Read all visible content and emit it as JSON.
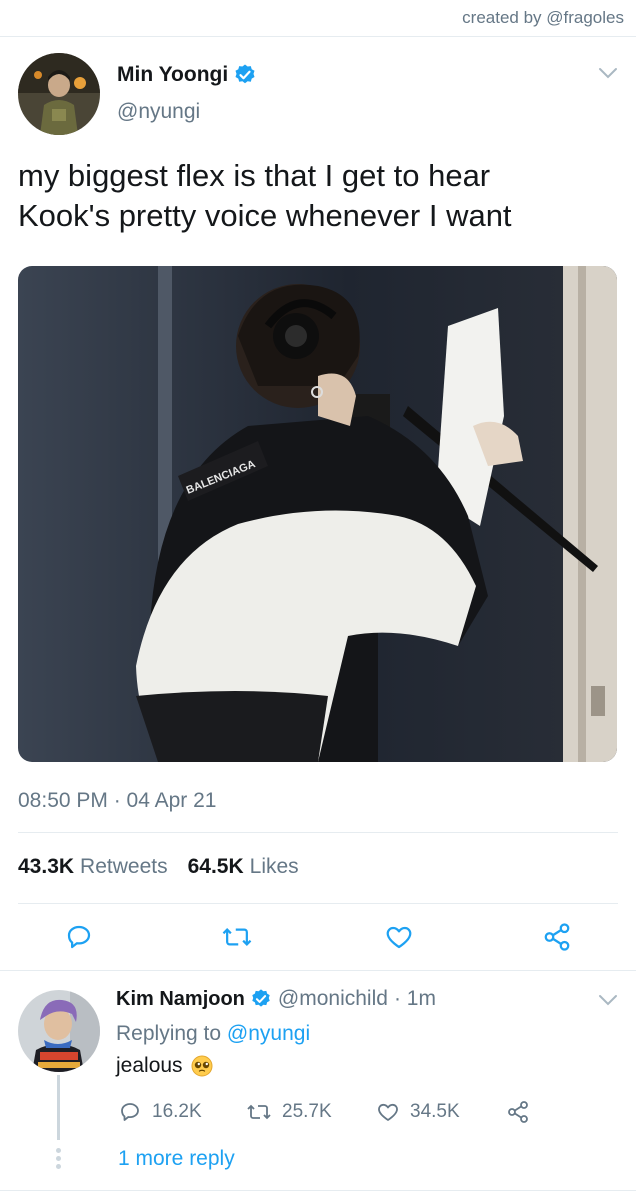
{
  "credit": "created by @fragoles",
  "tweet": {
    "name": "Min Yoongi",
    "handle": "@nyungi",
    "text_line1": "my biggest flex is that I get to hear",
    "text_line2": "Kook's pretty voice whenever I want",
    "jacket_text": "BALENCIAGA",
    "timestamp": "08:50 PM · 04 Apr 21",
    "retweets_count": "43.3K",
    "retweets_label": "Retweets",
    "likes_count": "64.5K",
    "likes_label": "Likes"
  },
  "reply": {
    "name": "Kim Namjoon",
    "handle": "@monichild",
    "time": "· 1m",
    "replying_prefix": "Replying to",
    "replying_to": "@nyungi",
    "text": "jealous",
    "replies": "16.2K",
    "retweets": "25.7K",
    "likes": "34.5K",
    "more_replies": "1 more reply"
  },
  "colors": {
    "accent": "#1da1f2",
    "secondary_text": "#657786",
    "icon": "#1da1f2"
  },
  "icons": [
    "verified-badge",
    "chevron-down",
    "reply",
    "retweet",
    "like",
    "share",
    "pleading-face-emoji"
  ]
}
